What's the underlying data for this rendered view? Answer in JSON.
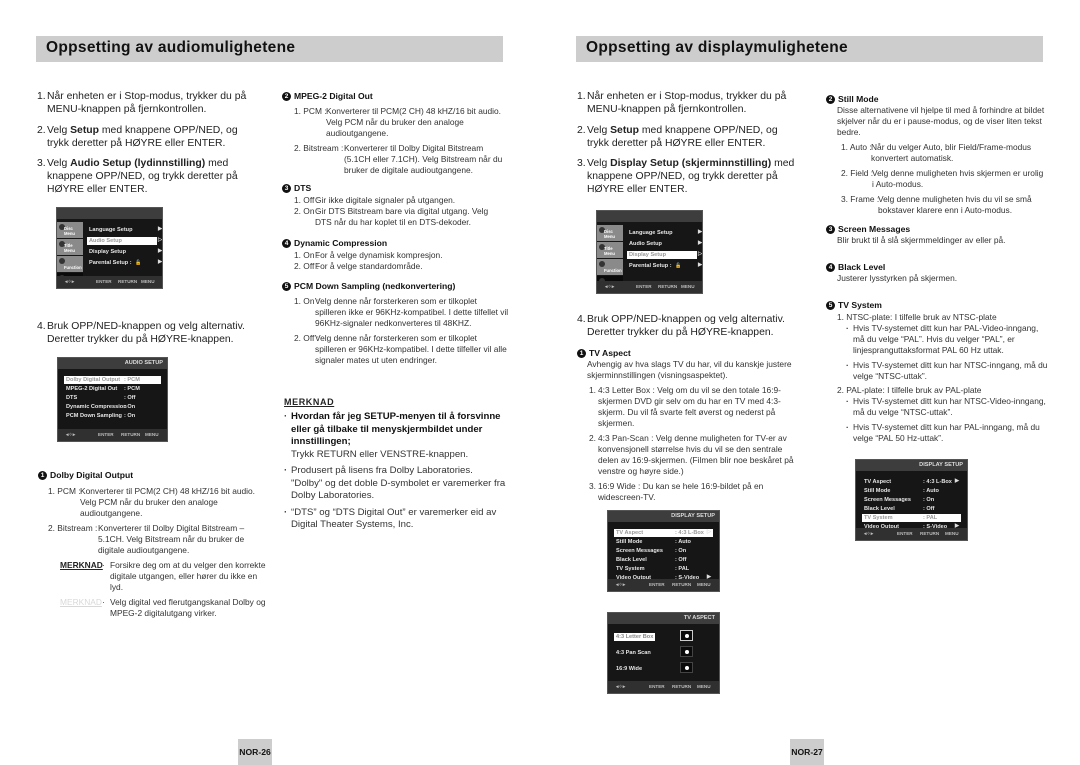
{
  "left_page": {
    "title": "Oppsetting av audiomulighetene",
    "steps": [
      {
        "num": "1.",
        "text": "Når enheten er i Stop-modus, trykker du på MENU-knappen på fjernkontrollen."
      },
      {
        "num": "2.",
        "pre": "Velg ",
        "bold": "Setup",
        "post": " med knappene OPP/NED, og trykk deretter på HØYRE eller ENTER."
      },
      {
        "num": "3.",
        "pre": "Velg ",
        "bold": "Audio Setup (lydinnstilling)",
        "post": " med knappene OPP/NED, og trykk deretter på HØYRE eller ENTER."
      },
      {
        "num": "4.",
        "text": "Bruk OPP/NED-knappen og velg alternativ. Deretter trykker du på HØYRE-knappen."
      }
    ],
    "setup_menu": {
      "tabs": [
        "Disc Menu",
        "Title Menu",
        "Function",
        "Setup"
      ],
      "items": [
        {
          "label": "Language Setup",
          "value": ""
        },
        {
          "label": "Audio Setup",
          "value": ""
        },
        {
          "label": "Display Setup",
          "value": ""
        },
        {
          "label": "Parental Setup :",
          "value": "lock-icon"
        }
      ],
      "selected": "Audio Setup",
      "footer": [
        "ENTER",
        "RETURN",
        "MENU"
      ]
    },
    "audio_setup_screen": {
      "title": "AUDIO SETUP",
      "rows": [
        {
          "label": "Dolby Digital Output",
          "value": ": PCM"
        },
        {
          "label": "MPEG-2 Digital Out",
          "value": ": PCM"
        },
        {
          "label": "DTS",
          "value": ": Off"
        },
        {
          "label": "Dynamic Compression",
          "value": ": On"
        },
        {
          "label": "PCM Down Sampling",
          "value": ": On"
        }
      ],
      "footer": [
        "ENTER",
        "RETURN",
        "MENU"
      ]
    },
    "dolby": {
      "badge": "1",
      "title": "Dolby Digital Output",
      "items": [
        {
          "label": "1. PCM :",
          "text": "Konverterer til PCM(2 CH) 48 kHZ/16 bit audio. Velg PCM når du bruker den analoge audioutgangene."
        },
        {
          "label": "2. Bitstream :",
          "text": "Konverterer til Dolby Digital Bitstream – 5.1CH. Velg Bitstream når du bruker de digitale audioutgangene."
        }
      ],
      "notes": [
        {
          "label": "MERKNAD",
          "text": "Forsikre deg om at du velger den korrekte digitale utgangen, eller hører du ikke en lyd."
        },
        {
          "label": "MERKNAD",
          "text": "Velg digital ved flerutgangskanal Dolby og MPEG-2 digitalutgang virker."
        }
      ]
    },
    "mpeg": {
      "badge": "2",
      "title": "MPEG-2 Digital Out",
      "items": [
        {
          "label": "1. PCM :",
          "text": "Konverterer til PCM(2 CH) 48 kHZ/16 bit audio. Velg PCM når du bruker den analoge audioutgangene."
        },
        {
          "label": "2. Bitstream :",
          "text": "Konverterer til Dolby Digital Bitstream (5.1CH eller 7.1CH). Velg Bitstream når du bruker de digitale audioutgangene."
        }
      ]
    },
    "dts": {
      "badge": "3",
      "title": "DTS",
      "items": [
        {
          "label": "1. Off :",
          "text": "Gir ikke digitale signaler på utgangen."
        },
        {
          "label": "2. On :",
          "text": "Gir DTS Bitstream bare via digital utgang. Velg DTS når du har koplet til en DTS-dekoder."
        }
      ]
    },
    "dynamic": {
      "badge": "4",
      "title": "Dynamic Compression",
      "items": [
        {
          "label": "1. On :",
          "text": "For å velge dynamisk kompresjon."
        },
        {
          "label": "2. Off :",
          "text": "For å velge standardområde."
        }
      ]
    },
    "pcm_down": {
      "badge": "5",
      "title": "PCM Down Sampling (nedkonvertering)",
      "items": [
        {
          "label": "1. On :",
          "text": "Velg denne når forsterkeren som er tilkoplet spilleren ikke er 96KHz-kompatibel. I dette tilfellet vil 96KHz-signaler nedkonverteres til 48KHZ."
        },
        {
          "label": "2. Off :",
          "text": "Velg denne når forsterkeren som er tilkoplet spilleren er 96KHz-kompatibel. I dette tilfeller vil alle signaler mates ut uten endringer."
        }
      ]
    },
    "merknad": {
      "heading": "MERKNAD",
      "bullets": [
        {
          "bold": "Hvordan får jeg SETUP-menyen til å forsvinne eller gå tilbake til menyskjermbildet under innstillingen;",
          "text": "Trykk RETURN eller VENSTRE-knappen."
        },
        {
          "bold": "",
          "text": "Produsert på lisens fra Dolby Laboratories. \"Dolby\" og det doble D-symbolet er varemerker fra Dolby Laboratories."
        },
        {
          "bold": "",
          "text": "“DTS” og “DTS Digital Out” er varemerker eid av Digital Theater Systems, Inc."
        }
      ]
    },
    "page_number": "NOR-26"
  },
  "right_page": {
    "title": "Oppsetting av displaymulighetene",
    "steps": [
      {
        "num": "1.",
        "text": "Når enheten er i Stop-modus, trykker du på MENU-knappen på fjernkontrollen."
      },
      {
        "num": "2.",
        "pre": "Velg ",
        "bold": "Setup",
        "post": " med knappene OPP/NED, og trykk deretter på HØYRE eller ENTER."
      },
      {
        "num": "3.",
        "pre": "Velg ",
        "bold": "Display Setup (skjerminnstilling)",
        "post": " med knappene OPP/NED, og trykk deretter på HØYRE eller ENTER."
      },
      {
        "num": "4.",
        "text": "Bruk OPP/NED-knappen og velg alternativ. Deretter trykker du på HØYRE-knappen."
      }
    ],
    "setup_menu": {
      "tabs": [
        "Disc Menu",
        "Title Menu",
        "Function",
        "Setup"
      ],
      "items": [
        {
          "label": "Language Setup",
          "value": ""
        },
        {
          "label": "Audio Setup",
          "value": ""
        },
        {
          "label": "Display Setup",
          "value": ""
        },
        {
          "label": "Parental Setup :",
          "value": "lock-icon"
        }
      ],
      "selected": "Display Setup",
      "footer": [
        "ENTER",
        "RETURN",
        "MENU"
      ]
    },
    "tv_aspect": {
      "badge": "1",
      "title": "TV Aspect",
      "intro": "Avhengig av hva slags TV du har, vil du kanskje justere skjerminnstillingen (visningsaspektet).",
      "items": [
        {
          "num": "1.",
          "text": "4:3 Letter Box : Velg om du vil se den totale 16:9-skjermen DVD gir selv om du har en TV med 4:3-skjerm. Du vil få svarte felt øverst og nederst på skjermen."
        },
        {
          "num": "2.",
          "text": "4:3 Pan-Scan : Velg denne muligheten for TV-er av konvensjonell størrelse hvis du vil se den sentrale delen av 16:9-skjermen. (Filmen blir noe beskåret på venstre og høyre side.)"
        },
        {
          "num": "3.",
          "text": "16:9 Wide : Du kan se hele 16:9-bildet på en widescreen-TV."
        }
      ]
    },
    "display_setup_screen_1": {
      "title": "DISPLAY SETUP",
      "rows": [
        {
          "label": "TV Aspect",
          "value": ": 4:3 L-Box"
        },
        {
          "label": "Still Mode",
          "value": ": Auto"
        },
        {
          "label": "Screen Messages",
          "value": ": On"
        },
        {
          "label": "Black Level",
          "value": ": Off"
        },
        {
          "label": "TV System",
          "value": ": PAL"
        },
        {
          "label": "Video Output",
          "value": ": S-Video"
        }
      ],
      "selected": "TV Aspect",
      "footer": [
        "ENTER",
        "RETURN",
        "MENU"
      ]
    },
    "tv_aspect_screen": {
      "title": "TV ASPECT",
      "options": [
        "4:3 Letter Box",
        "4:3 Pan Scan",
        "16:9 Wide"
      ],
      "selected": "4:3 Letter Box",
      "footer": [
        "ENTER",
        "RETURN",
        "MENU"
      ]
    },
    "still_mode": {
      "badge": "2",
      "title": "Still Mode",
      "intro": "Disse alternativene vil hjelpe til med å forhindre at bildet skjelver når du er i pause-modus, og de viser liten tekst bedre.",
      "items": [
        {
          "label": "1. Auto :",
          "text": "Når du velger Auto, blir Field/Frame-modus konvertert automatisk."
        },
        {
          "label": "2. Field :",
          "text": "Velg denne muligheten hvis skjermen er urolig i Auto-modus."
        },
        {
          "label": "3. Frame :",
          "text": "Velg denne muligheten hvis du vil se små bokstaver klarere enn i Auto-modus."
        }
      ]
    },
    "screen_messages": {
      "badge": "3",
      "title": "Screen Messages",
      "text": "Blir brukt til å slå skjermmeldinger av eller på."
    },
    "black_level": {
      "badge": "4",
      "title": "Black Level",
      "text": "Justerer lysstyrken på skjermen."
    },
    "tv_system": {
      "badge": "5",
      "title": "TV System",
      "groups": [
        {
          "head": "1. NTSC-plate: I tilfelle bruk av NTSC-plate",
          "bullets": [
            "Hvis TV-systemet ditt kun har PAL-Video-inngang, må du velge “PAL”. Hvis du velger “PAL”, er linjespranguttaksformat PAL 60 Hz uttak.",
            "Hvis TV-systemet ditt kun har NTSC-inngang, må du velge “NTSC-uttak”."
          ]
        },
        {
          "head": "2. PAL-plate: I tilfelle bruk av PAL-plate",
          "bullets": [
            "Hvis TV-systemet ditt kun har NTSC-Video-inngang, må du velge “NTSC-uttak”.",
            "Hvis TV-systemet ditt kun har PAL-inngang, må du velge “PAL 50 Hz-uttak”."
          ]
        }
      ]
    },
    "display_setup_screen_2": {
      "title": "DISPLAY SETUP",
      "rows": [
        {
          "label": "TV Aspect",
          "value": ": 4:3 L-Box"
        },
        {
          "label": "Still Mode",
          "value": ": Auto"
        },
        {
          "label": "Screen Messages",
          "value": ": On"
        },
        {
          "label": "Black Level",
          "value": ": Off"
        },
        {
          "label": "TV System",
          "value": ": PAL"
        },
        {
          "label": "Video Output",
          "value": ": S-Video"
        }
      ],
      "selected": "TV System",
      "footer": [
        "ENTER",
        "RETURN",
        "MENU"
      ]
    },
    "page_number": "NOR-27"
  }
}
